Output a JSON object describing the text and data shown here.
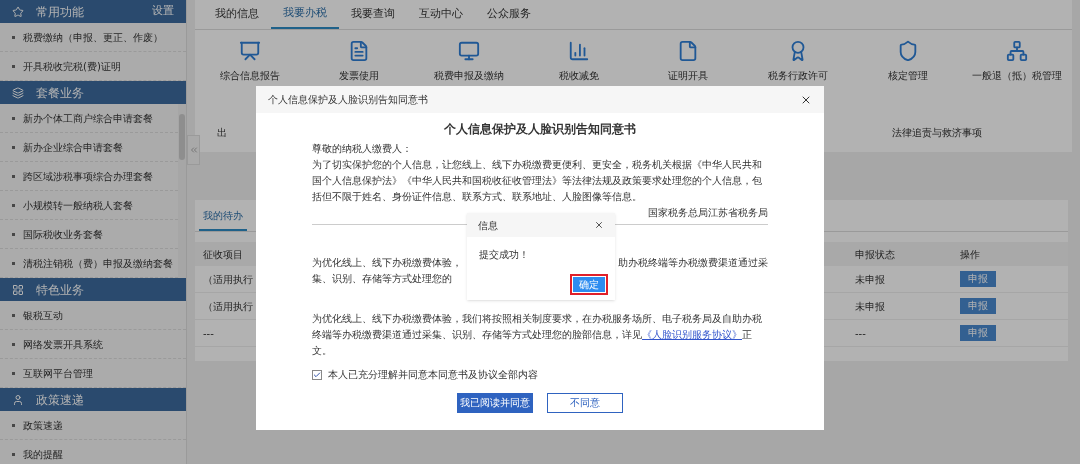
{
  "sidebar": {
    "sections": [
      {
        "title": "常用功能",
        "action": "设置",
        "items": [
          "税费缴纳（申报、更正、作废）",
          "开具税收完税(费)证明"
        ]
      },
      {
        "title": "套餐业务",
        "items": [
          "新办个体工商户综合申请套餐",
          "新办企业综合申请套餐",
          "跨区域涉税事项综合办理套餐",
          "小规模转一般纳税人套餐",
          "国际税收业务套餐",
          "清税注销税（费）申报及缴纳套餐"
        ],
        "scrollable": true
      },
      {
        "title": "特色业务",
        "items": [
          "银税互动",
          "网络发票开具系统",
          "互联网平台管理"
        ]
      },
      {
        "title": "政策速递",
        "items": [
          "政策速递",
          "我的提醒"
        ]
      }
    ]
  },
  "tabs": [
    {
      "label": "我的信息",
      "selected": false
    },
    {
      "label": "我要办税",
      "selected": true
    },
    {
      "label": "我要查询",
      "selected": false
    },
    {
      "label": "互动中心",
      "selected": false
    },
    {
      "label": "公众服务",
      "selected": false
    }
  ],
  "services": [
    "综合信息报告",
    "发票使用",
    "税费申报及缴纳",
    "税收减免",
    "证明开具",
    "税务行政许可",
    "核定管理",
    "一般退（抵）税管理"
  ],
  "services_row2": {
    "left": "出",
    "right": "法律追责与救济事项"
  },
  "pending": {
    "tab": "我的待办",
    "columns": [
      "征收项目",
      "申报状态",
      "操作"
    ],
    "rows": [
      {
        "item": "（适用执行",
        "status": "未申报",
        "action": "申报"
      },
      {
        "item": "（适用执行",
        "status": "未申报",
        "action": "申报"
      },
      {
        "item": "---",
        "status": "---",
        "action": "申报"
      }
    ]
  },
  "consent": {
    "window_title": "个人信息保护及人脸识别告知同意书",
    "heading": "个人信息保护及人脸识别告知同意书",
    "greeting": "尊敬的纳税人缴费人：",
    "intro": "为了切实保护您的个人信息，让您线上、线下办税缴费更便利、更安全，税务机关根据《中华人民共和国个人信息保护法》《中华人民共和国税收征收管理法》等法律法规及政策要求处理您的个人信息，包括但不限于姓名、身份证件信息、联系方式、联系地址、人脸图像等信息。",
    "signature": "国家税务总局江苏省税务局",
    "para1": {
      "line1_left": "为优化线上、线下办税缴费体验，",
      "line1_right": "助办税终端等办税缴费渠道通过采",
      "line2": "集、识别、存储等方式处理您的"
    },
    "para2": {
      "text": "为优化线上、线下办税缴费体验，我们将按照相关制度要求，在办税服务场所、电子税务局及自助办税终端等办税缴费渠道通过采集、识别、存储等方式处理您的脸部信息，详见",
      "link": "《人脸识别服务协议》",
      "after": "正文。"
    },
    "agree": {
      "label": "本人已充分理解并同意本同意书及协议全部内容",
      "checked": true
    },
    "buttons": [
      {
        "label": "我已阅读并同意",
        "kind": "primary"
      },
      {
        "label": "不同意",
        "kind": "outline"
      }
    ]
  },
  "info": {
    "title": "信息",
    "message": "提交成功！",
    "button": {
      "label": "确定",
      "highlighted": true
    }
  }
}
